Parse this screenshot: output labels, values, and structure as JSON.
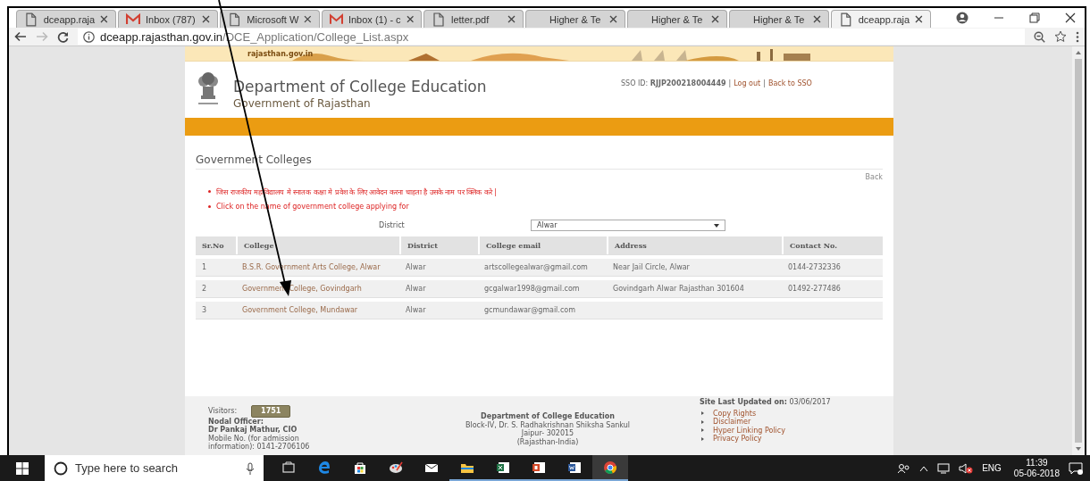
{
  "browser": {
    "tabs": [
      {
        "title": "dceapp.raja",
        "kind": "page",
        "selected": false
      },
      {
        "title": "Inbox (787)",
        "kind": "mail",
        "selected": false
      },
      {
        "title": "Microsoft W",
        "kind": "page",
        "selected": false
      },
      {
        "title": "Inbox (1) - c",
        "kind": "mail",
        "selected": false
      },
      {
        "title": "letter.pdf",
        "kind": "page",
        "selected": false
      },
      {
        "title": "Higher & Te",
        "kind": "none",
        "selected": false
      },
      {
        "title": "Higher & Te",
        "kind": "none",
        "selected": false
      },
      {
        "title": "Higher & Te",
        "kind": "none",
        "selected": false
      },
      {
        "title": "dceapp.raja",
        "kind": "page",
        "selected": true
      }
    ],
    "url_host": "dceapp.rajasthan.gov.in",
    "url_path": "/DCE_Application/College_List.aspx"
  },
  "header": {
    "banner_site": "rajasthan.gov.in",
    "title": "Department of College Education",
    "subtitle": "Government of Rajasthan",
    "sso": "SSO ID: **RJJP200218004449**",
    "separator": "|",
    "links": [
      "Log out",
      "Back to SSO"
    ]
  },
  "page": {
    "heading": "Government Colleges",
    "back": "Back",
    "notes": [
      "जिस राजकीय महाविद्यालय मे स्नातक कक्षा मे प्रवेश के लिए आवेदन करना चाहता है उसके नाम पर क्लिक करे |",
      "Click on the name of government college applying for"
    ],
    "district_label": "District",
    "district_value": "Alwar"
  },
  "table": {
    "columns": [
      "Sr.No",
      "College",
      "District",
      "College email",
      "Address",
      "Contact No."
    ],
    "rows": [
      {
        "sr": "1",
        "college": "B.S.R. Government Arts College, Alwar",
        "district": "Alwar",
        "email": "artscollegealwar@gmail.com",
        "address": "Near Jail Circle, Alwar",
        "contact": "0144-2732336"
      },
      {
        "sr": "2",
        "college": "Government College, Govindgarh",
        "district": "Alwar",
        "email": "gcgalwar1998@gmail.com",
        "address": "Govindgarh Alwar Rajasthan 301604",
        "contact": "01492-277486"
      },
      {
        "sr": "3",
        "college": "Government College, Mundawar",
        "district": "Alwar",
        "email": "gcmundawar@gmail.com"
      }
    ]
  },
  "footer": {
    "visitors_label": "Visitors:",
    "visitors": "1751",
    "officer_label": "Nodal Officer:",
    "officer": "Dr Pankaj Mathur, CIO",
    "mobile": "Mobile No. (for admission information): 0141-2706106",
    "org": "Department of College Education",
    "address": [
      "Block-IV, Dr. S. Radhakrishnan Shiksha Sankul",
      "Jaipur- 302015",
      "(Rajasthan-India)"
    ],
    "updated": "**Site Last Updated on:** 03/06/2017",
    "links": [
      "Copy Rights",
      "Disclaimer",
      "Hyper Linking Policy",
      "Privacy Policy"
    ]
  },
  "taskbar": {
    "search_placeholder": "Type here to search",
    "apps": [
      {
        "kind": "taskview",
        "open": false,
        "selected": false
      },
      {
        "kind": "edge",
        "open": false,
        "selected": false
      },
      {
        "kind": "store",
        "open": false,
        "selected": false
      },
      {
        "kind": "paint",
        "open": false,
        "selected": false
      },
      {
        "kind": "mail",
        "open": false,
        "selected": false
      },
      {
        "kind": "folder",
        "open": true,
        "selected": false
      },
      {
        "kind": "excel",
        "open": true,
        "selected": false
      },
      {
        "kind": "powerpoint",
        "open": true,
        "selected": false
      },
      {
        "kind": "word",
        "open": true,
        "selected": false
      },
      {
        "kind": "chrome",
        "open": true,
        "selected": true
      }
    ],
    "lang": "ENG",
    "time": "11:39",
    "date": "05-06-2018"
  }
}
